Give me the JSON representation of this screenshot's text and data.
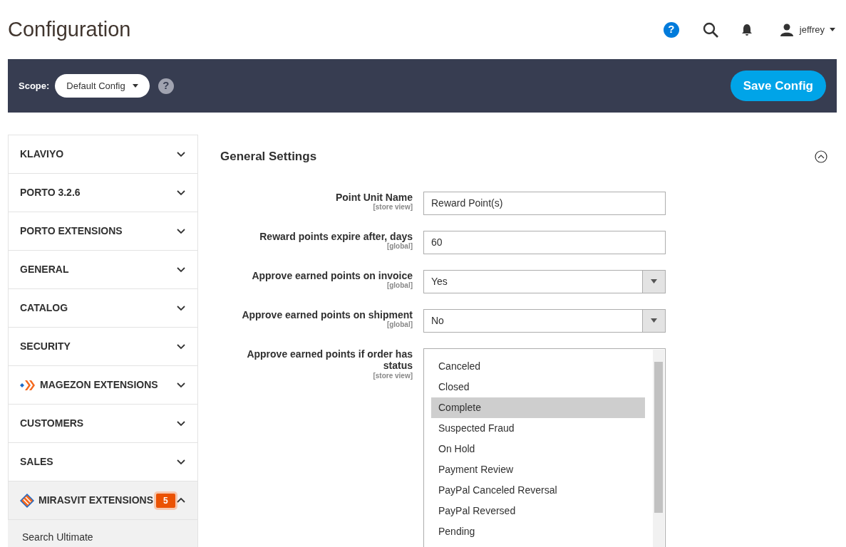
{
  "page_title": "Configuration",
  "header": {
    "help": "?",
    "user": "jeffrey"
  },
  "toolbar": {
    "scope_label": "Scope:",
    "scope_help": "?",
    "scope_value": "Default Config",
    "save_button": "Save Config"
  },
  "sidebar": {
    "items": [
      {
        "label": "KLAVIYO",
        "kind": "plain",
        "expanded": false
      },
      {
        "label": "PORTO 3.2.6",
        "kind": "plain",
        "expanded": false
      },
      {
        "label": "PORTO EXTENSIONS",
        "kind": "plain",
        "expanded": false
      },
      {
        "label": "GENERAL",
        "kind": "plain",
        "expanded": false
      },
      {
        "label": "CATALOG",
        "kind": "plain",
        "expanded": false
      },
      {
        "label": "SECURITY",
        "kind": "plain",
        "expanded": false
      },
      {
        "label": "MAGEZON EXTENSIONS",
        "kind": "chevron-logo",
        "expanded": false
      },
      {
        "label": "CUSTOMERS",
        "kind": "plain",
        "expanded": false
      },
      {
        "label": "SALES",
        "kind": "plain",
        "expanded": false
      },
      {
        "label": "MIRASVIT EXTENSIONS",
        "kind": "diamond-logo",
        "expanded": true,
        "badge": "5",
        "children": [
          {
            "label": "Search Ultimate"
          }
        ]
      }
    ]
  },
  "section": {
    "title": "General Settings",
    "expanded": true,
    "fields": [
      {
        "kind": "text",
        "label": "Point Unit Name",
        "scope": "[store view]",
        "value": "Reward Point(s)"
      },
      {
        "kind": "text",
        "label": "Reward points expire after, days",
        "scope": "[global]",
        "value": "60"
      },
      {
        "kind": "select",
        "label": "Approve earned points on invoice",
        "scope": "[global]",
        "value": "Yes"
      },
      {
        "kind": "select",
        "label": "Approve earned points on shipment",
        "scope": "[global]",
        "value": "No"
      },
      {
        "kind": "multiselect",
        "label": "Approve earned points if order has status",
        "scope": "[store view]",
        "options": [
          {
            "label": "Canceled",
            "selected": false
          },
          {
            "label": "Closed",
            "selected": false
          },
          {
            "label": "Complete",
            "selected": true
          },
          {
            "label": "Suspected Fraud",
            "selected": false
          },
          {
            "label": "On Hold",
            "selected": false
          },
          {
            "label": "Payment Review",
            "selected": false
          },
          {
            "label": "PayPal Canceled Reversal",
            "selected": false
          },
          {
            "label": "PayPal Reversed",
            "selected": false
          },
          {
            "label": "Pending",
            "selected": false
          }
        ]
      }
    ]
  }
}
